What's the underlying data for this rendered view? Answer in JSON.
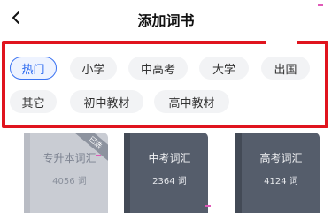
{
  "header": {
    "back_icon": "chevron-left-icon",
    "title": "添加词书"
  },
  "highlight_color": "#e0141e",
  "categories": [
    {
      "label": "热门",
      "active": true
    },
    {
      "label": "小学",
      "active": false
    },
    {
      "label": "中高考",
      "active": false
    },
    {
      "label": "大学",
      "active": false
    },
    {
      "label": "出国",
      "active": false
    },
    {
      "label": "其它",
      "active": false
    },
    {
      "label": "初中教材",
      "active": false
    },
    {
      "label": "高中教材",
      "active": false
    }
  ],
  "books": [
    {
      "name": "专升本词汇",
      "count": "4056 词",
      "selected": true,
      "badge": "已选"
    },
    {
      "name": "中考词汇",
      "count": "2364 词",
      "selected": false
    },
    {
      "name": "高考词汇",
      "count": "4124 词",
      "selected": false
    }
  ]
}
